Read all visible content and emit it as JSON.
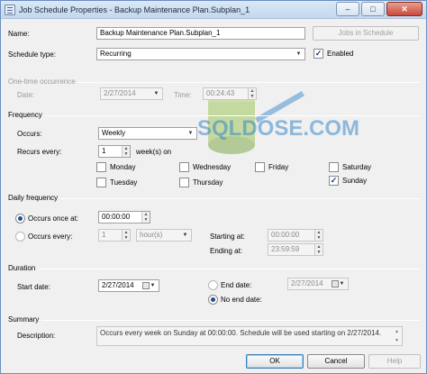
{
  "window": {
    "title": "Job Schedule Properties - Backup Maintenance Plan.Subplan_1",
    "minimize": "–",
    "maximize": "□",
    "close": "✕"
  },
  "general": {
    "name_label": "Name:",
    "name_value": "Backup Maintenance Plan.Subplan_1",
    "jobs_button": "Jobs in Schedule",
    "schedule_type_label": "Schedule type:",
    "schedule_type_value": "Recurring",
    "enabled_label": "Enabled",
    "enabled_checked": true
  },
  "one_time": {
    "section": "One-time occurrence",
    "date_label": "Date:",
    "date_value": "2/27/2014",
    "time_label": "Time:",
    "time_value": "00:24:43"
  },
  "frequency": {
    "section": "Frequency",
    "occurs_label": "Occurs:",
    "occurs_value": "Weekly",
    "recurs_label": "Recurs every:",
    "recurs_value": "1",
    "recurs_unit": "week(s) on",
    "days": [
      {
        "label": "Monday",
        "checked": false
      },
      {
        "label": "Wednesday",
        "checked": false
      },
      {
        "label": "Friday",
        "checked": false
      },
      {
        "label": "Saturday",
        "checked": false
      },
      {
        "label": "Tuesday",
        "checked": false
      },
      {
        "label": "Thursday",
        "checked": false
      },
      {
        "label": "Sunday",
        "checked": true
      }
    ]
  },
  "daily": {
    "section": "Daily frequency",
    "once_label": "Occurs once at:",
    "once_value": "00:00:00",
    "every_label": "Occurs every:",
    "every_value": "1",
    "every_unit": "hour(s)",
    "starting_label": "Starting at:",
    "starting_value": "00:00:00",
    "ending_label": "Ending at:",
    "ending_value": "23:59:59"
  },
  "duration": {
    "section": "Duration",
    "start_label": "Start date:",
    "start_value": "2/27/2014",
    "end_label": "End date:",
    "end_value": "2/27/2014",
    "no_end_label": "No end date:"
  },
  "summary": {
    "section": "Summary",
    "description_label": "Description:",
    "description_value": "Occurs every week on Sunday at 00:00:00. Schedule will be used starting on 2/27/2014."
  },
  "buttons": {
    "ok": "OK",
    "cancel": "Cancel",
    "help": "Help"
  },
  "watermark": {
    "text": "SQLDOSE.COM"
  },
  "colors": {
    "accent": "#1e4f93",
    "watermark": "#2d7fc7"
  }
}
